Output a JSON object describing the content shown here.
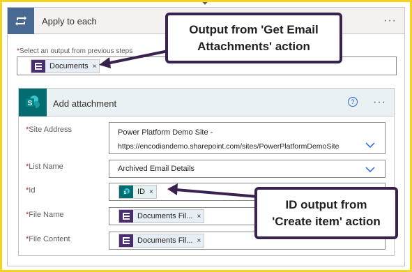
{
  "apply_to_each": {
    "title": "Apply to each",
    "more": "···",
    "select_label_required": "*",
    "select_label": "Select an output from previous steps",
    "token": {
      "label": "Documents",
      "remove": "×"
    }
  },
  "add_attachment": {
    "title": "Add attachment",
    "help": "?",
    "more": "···",
    "fields": {
      "site_address": {
        "label": "Site Address",
        "value_line1": "Power Platform Demo Site -",
        "value_line2": "https://encodiandemo.sharepoint.com/sites/PowerPlatformDemoSite"
      },
      "list_name": {
        "label": "List Name",
        "value": "Archived Email Details"
      },
      "id": {
        "label": "Id",
        "token": "ID",
        "remove": "×"
      },
      "file_name": {
        "label": "File Name",
        "token": "Documents Fil...",
        "remove": "×"
      },
      "file_content": {
        "label": "File Content",
        "token": "Documents Fil...",
        "remove": "×"
      }
    },
    "required_marker": "*"
  },
  "callouts": {
    "top": {
      "line1": "Output from 'Get Email",
      "line2": "Attachments' action"
    },
    "bottom": {
      "line1": "ID output from",
      "line2": "'Create item' action"
    }
  },
  "colors": {
    "frame": "#f5d320",
    "apply_icon_bg": "#486991",
    "sharepoint_teal": "#036c70",
    "encodian_purple": "#4a2c70",
    "callout_border": "#3a2250"
  }
}
